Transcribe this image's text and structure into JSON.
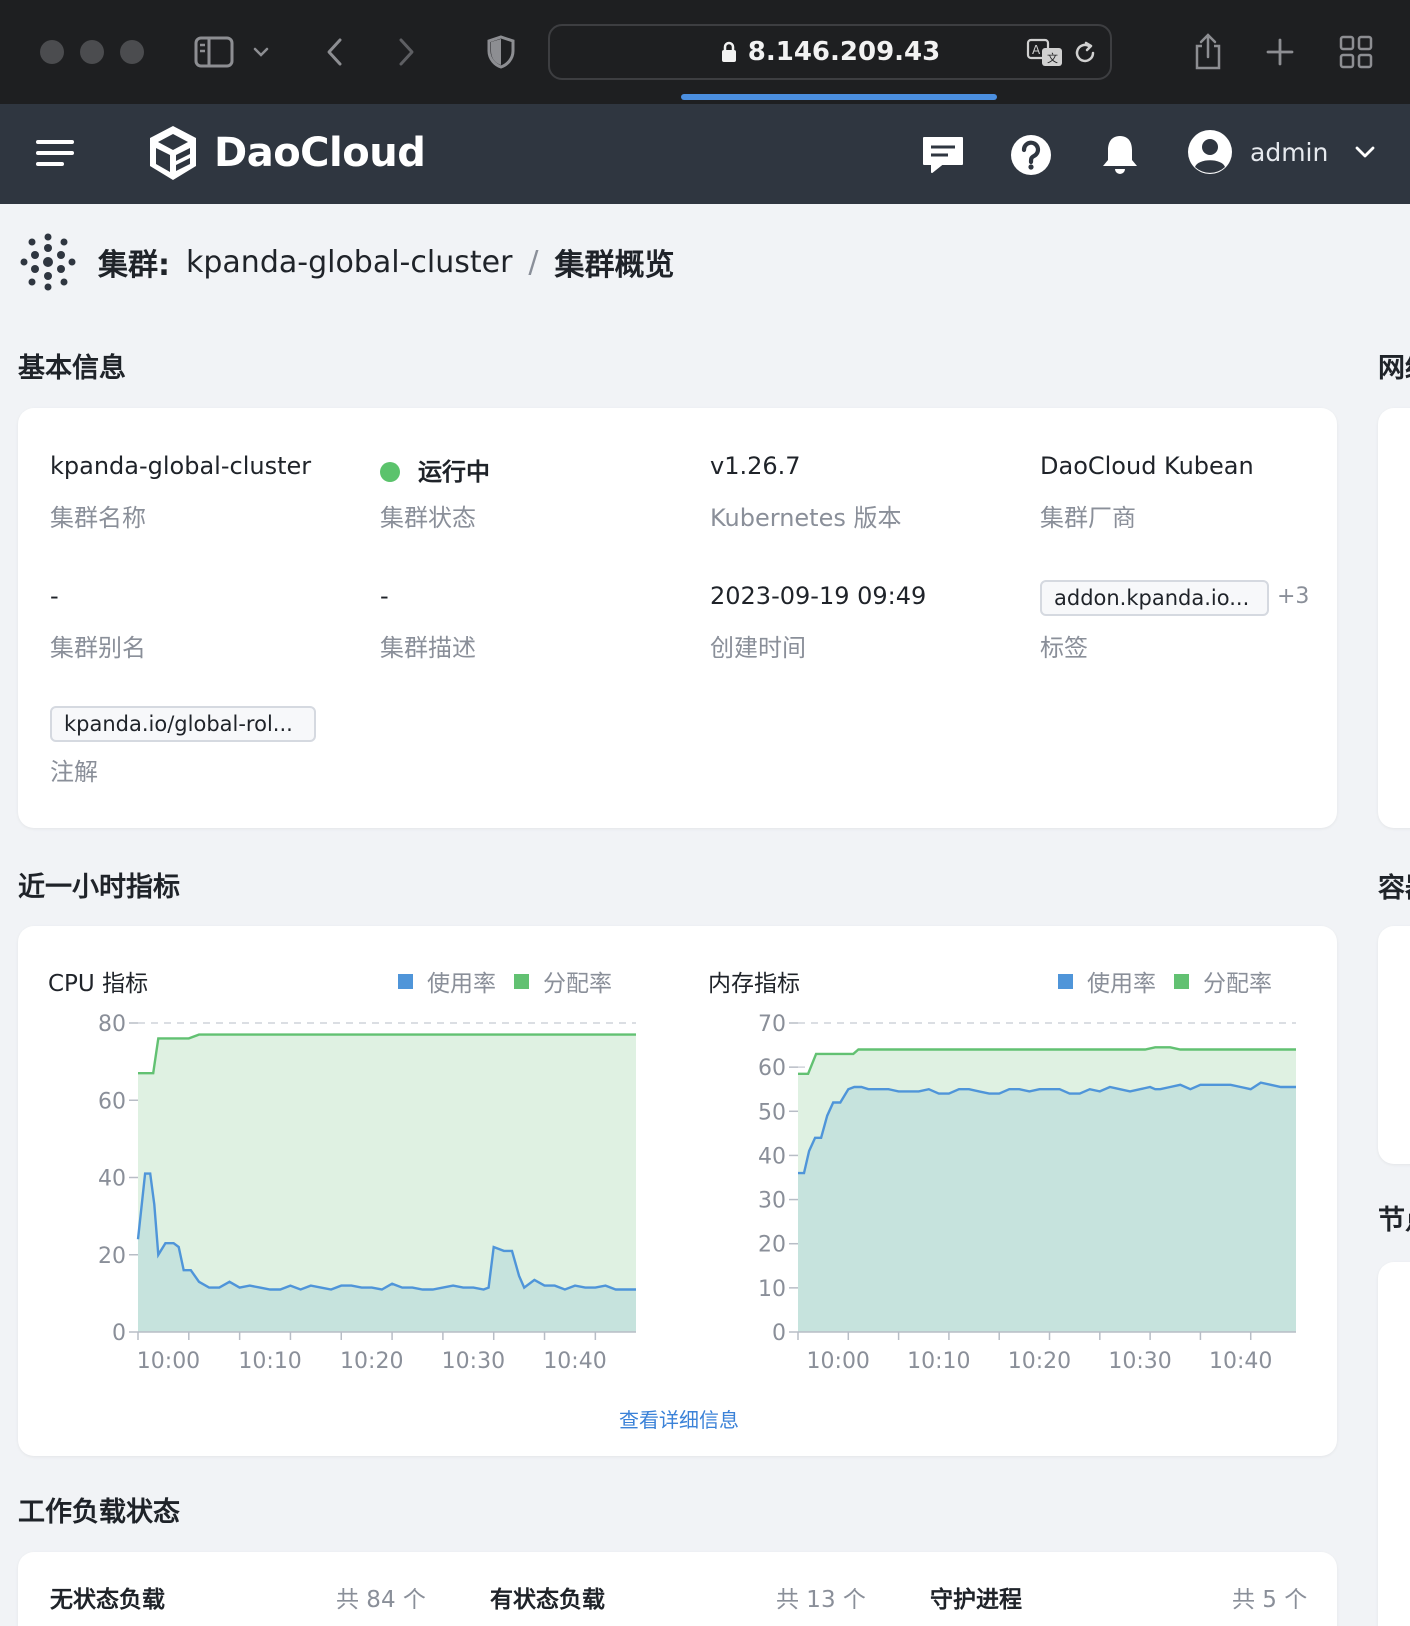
{
  "browser": {
    "url": "8.146.209.43"
  },
  "header": {
    "brand": "DaoCloud",
    "user": "admin"
  },
  "breadcrumb": {
    "label": "集群:",
    "cluster": "kpanda-global-cluster",
    "separator": "/",
    "current": "集群概览"
  },
  "basic_info": {
    "title": "基本信息",
    "fields": [
      {
        "value": "kpanda-global-cluster",
        "key": "集群名称"
      },
      {
        "value": "运行中",
        "key": "集群状态"
      },
      {
        "value": "v1.26.7",
        "key": "Kubernetes 版本"
      },
      {
        "value": "DaoCloud Kubean",
        "key": "集群厂商"
      },
      {
        "value": "-",
        "key": "集群别名"
      },
      {
        "value": "-",
        "key": "集群描述"
      },
      {
        "value": "2023-09-19 09:49",
        "key": "创建时间"
      },
      {
        "value": "addon.kpanda.io...",
        "extra": "+3",
        "key": "标签"
      },
      {
        "value": "kpanda.io/global-rol...",
        "key": "注解"
      }
    ]
  },
  "side_titles": [
    "网络",
    "容器",
    "节点"
  ],
  "metrics": {
    "title": "近一小时指标",
    "detail_link": "查看详细信息",
    "legend_usage": "使用率",
    "legend_alloc": "分配率"
  },
  "colors": {
    "usage": "#4f95d9",
    "alloc": "#62c172",
    "usage_fill": "#c6e3dd",
    "alloc_fill": "#dff1e2",
    "header_bg": "#2f3640",
    "page_bg": "#f1f3f6"
  },
  "chart_data": [
    {
      "type": "area",
      "title": "CPU 指标",
      "ylim": [
        0,
        80
      ],
      "yticks": [
        0,
        20,
        40,
        60,
        80
      ],
      "xtick_labels": [
        "10:00",
        "10:10",
        "10:20",
        "10:30",
        "10:40"
      ],
      "xtick_minutes": [
        3,
        13,
        23,
        33,
        43
      ],
      "x_range_minutes": [
        0,
        49
      ],
      "grid": true,
      "legend": "top-right",
      "series": [
        {
          "name": "分配率",
          "x": [
            0,
            1.5,
            2,
            3,
            4,
            5,
            6,
            49
          ],
          "values": [
            67,
            67,
            76,
            76,
            76,
            76,
            77,
            77
          ]
        },
        {
          "name": "使用率",
          "x": [
            0,
            0.7,
            1.2,
            1.6,
            2,
            2.7,
            3.5,
            4,
            4.5,
            5.2,
            6,
            7,
            8,
            9,
            10,
            11,
            12,
            13,
            14,
            15,
            16,
            17,
            18,
            19,
            20,
            21,
            22,
            23,
            24,
            25,
            26,
            27,
            28,
            29,
            30,
            31,
            32,
            33,
            34,
            34.5,
            35,
            36,
            36.8,
            37.5,
            38,
            39,
            40,
            41,
            42,
            43,
            44,
            45,
            46,
            47,
            48,
            49
          ],
          "values": [
            24,
            41,
            41,
            33,
            20,
            23,
            23,
            22,
            16,
            16,
            13,
            11.5,
            11.5,
            13,
            11.5,
            12,
            11.5,
            11,
            11,
            12,
            11,
            12,
            11.5,
            11,
            12,
            12,
            11.5,
            11.5,
            11,
            12.5,
            11.5,
            11.5,
            11,
            11,
            11.5,
            12,
            11.5,
            11.5,
            11,
            11.5,
            22,
            21,
            21,
            14.5,
            11.5,
            13.5,
            12,
            12,
            11,
            12,
            11.5,
            11.5,
            12,
            11,
            11,
            11
          ]
        }
      ]
    },
    {
      "type": "area",
      "title": "内存指标",
      "ylim": [
        0,
        70
      ],
      "yticks": [
        0,
        10,
        20,
        30,
        40,
        50,
        60,
        70
      ],
      "xtick_labels": [
        "10:00",
        "10:10",
        "10:20",
        "10:30",
        "10:40"
      ],
      "xtick_minutes": [
        4,
        14,
        24,
        34,
        44
      ],
      "x_range_minutes": [
        0,
        49.5
      ],
      "grid": true,
      "legend": "top-right",
      "series": [
        {
          "name": "分配率",
          "x": [
            0,
            1,
            1.8,
            2.2,
            5.5,
            6,
            34.5,
            35.5,
            37,
            38,
            49.5
          ],
          "values": [
            58.5,
            58.5,
            63,
            63,
            63,
            64,
            64,
            64.5,
            64.5,
            64,
            64
          ]
        },
        {
          "name": "使用率",
          "x": [
            0,
            0.6,
            1.1,
            1.7,
            2.3,
            2.9,
            3.5,
            4.2,
            5,
            5.6,
            6.3,
            7,
            8,
            9,
            10,
            11,
            12,
            13,
            14,
            15,
            16,
            17,
            18,
            19,
            20,
            21,
            22,
            23,
            24,
            25,
            26,
            27,
            28,
            29,
            30,
            31,
            32,
            33,
            34,
            35,
            35.5,
            36,
            37,
            38,
            39,
            40,
            41,
            42,
            43,
            44,
            45,
            46,
            47,
            48,
            49.5
          ],
          "values": [
            36,
            36,
            41,
            44,
            44,
            49,
            52,
            52,
            55,
            55.5,
            55.5,
            55,
            55,
            55,
            54.5,
            54.5,
            54.5,
            55,
            54,
            54,
            55,
            55,
            54.5,
            54,
            54,
            55,
            55,
            54.5,
            55,
            55,
            55,
            54,
            54,
            55,
            54.5,
            55.5,
            55,
            54.5,
            55,
            55.5,
            55,
            55,
            55.5,
            56,
            55,
            56,
            56,
            56,
            56,
            55.5,
            55,
            56.5,
            56,
            55.5,
            55.5
          ]
        }
      ]
    }
  ],
  "workload": {
    "title": "工作负载状态",
    "items": [
      {
        "label": "无状态负载",
        "count": "共 84 个"
      },
      {
        "label": "有状态负载",
        "count": "共 13 个"
      },
      {
        "label": "守护进程",
        "count": "共 5 个"
      }
    ]
  }
}
